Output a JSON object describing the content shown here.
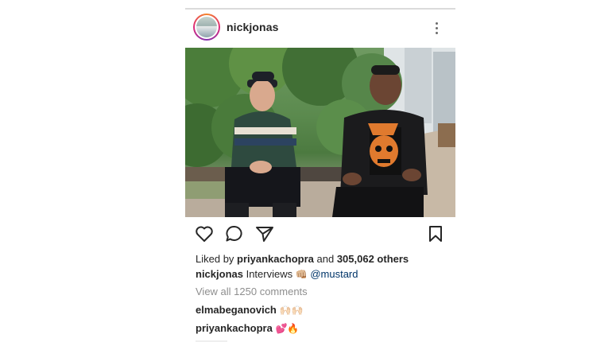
{
  "post": {
    "username": "nickjonas",
    "more_icon": "more-vertical-icon",
    "photo_alt": "Two men sitting outdoors",
    "actions": {
      "like_icon": "heart-icon",
      "comment_icon": "comment-icon",
      "share_icon": "send-icon",
      "save_icon": "bookmark-icon"
    },
    "likes": {
      "prefix": "Liked by",
      "user": "priyankachopra",
      "and": "and",
      "others": "305,062 others"
    },
    "caption": {
      "user": "nickjonas",
      "text": "Interviews",
      "emoji": "👊🏼",
      "mention": "@mustard"
    },
    "view_all_comments": "View all 1250 comments",
    "comments": [
      {
        "user": "elmabeganovich",
        "text": "🙌🏻🙌🏻"
      },
      {
        "user": "priyankachopra",
        "text": "💕🔥"
      }
    ]
  }
}
